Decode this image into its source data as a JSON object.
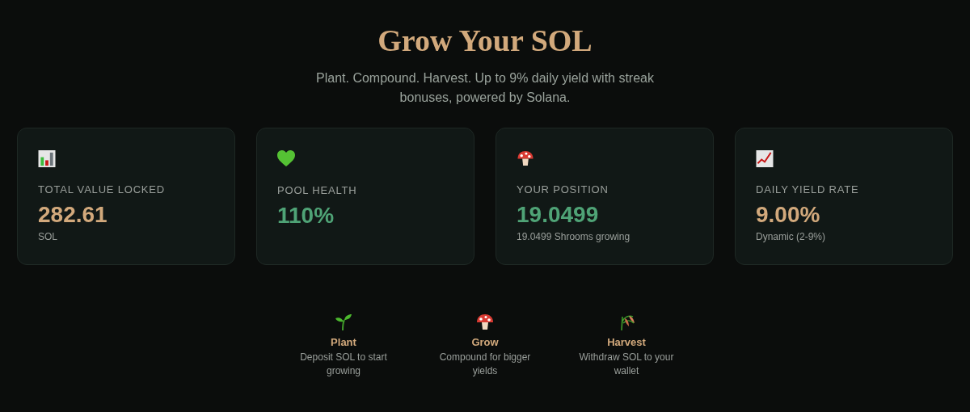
{
  "hero": {
    "title": "Grow Your SOL",
    "subtitle": "Plant. Compound. Harvest. Up to 9% daily yield with streak bonuses, powered by Solana."
  },
  "stats": [
    {
      "kind": "bar-chart",
      "label": "TOTAL VALUE LOCKED",
      "value": "282.61",
      "color": "#d2a97c",
      "note": "SOL"
    },
    {
      "kind": "heart",
      "label": "POOL HEALTH",
      "value": "110%",
      "color": "#4fa376"
    },
    {
      "kind": "mushroom",
      "label": "YOUR POSITION",
      "value": "19.0499",
      "color": "#4fa376",
      "note": "19.0499 Shrooms growing"
    },
    {
      "kind": "trend",
      "label": "DAILY YIELD RATE",
      "value": "9.00%",
      "color": "#d2a97c",
      "note": "Dynamic (2-9%)"
    }
  ],
  "steps": [
    {
      "kind": "sprout",
      "title": "Plant",
      "text": "Deposit SOL to start growing"
    },
    {
      "kind": "mushroom",
      "title": "Grow",
      "text": "Compound for bigger yields"
    },
    {
      "kind": "grain",
      "title": "Harvest",
      "text": "Withdraw SOL to your wallet"
    }
  ]
}
